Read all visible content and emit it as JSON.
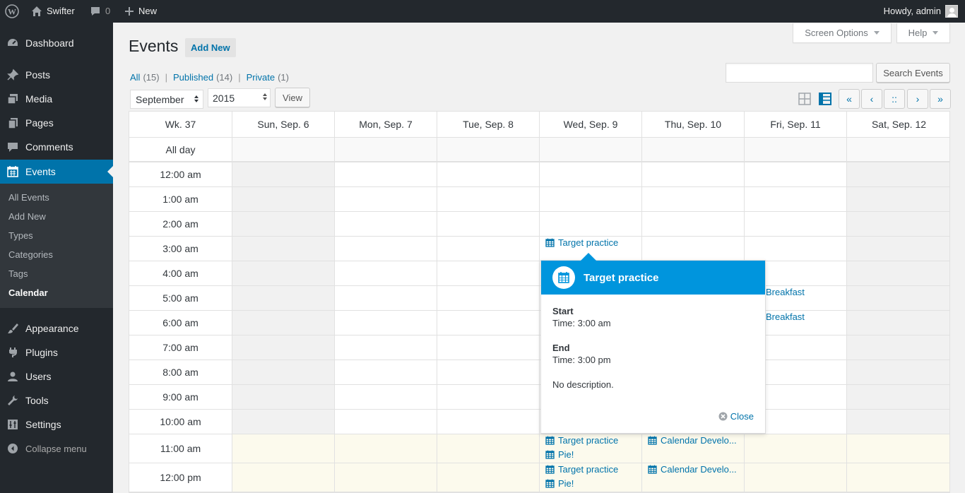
{
  "admin_bar": {
    "site_name": "Swifter",
    "comments_count": "0",
    "new_label": "New",
    "howdy": "Howdy, admin"
  },
  "sidebar": {
    "items": [
      {
        "label": "Dashboard",
        "icon": "dashboard-icon"
      },
      {
        "label": "Posts",
        "icon": "pin-icon"
      },
      {
        "label": "Media",
        "icon": "media-icon"
      },
      {
        "label": "Pages",
        "icon": "pages-icon"
      },
      {
        "label": "Comments",
        "icon": "comment-icon"
      },
      {
        "label": "Events",
        "icon": "calendar-icon",
        "current": true
      },
      {
        "label": "Appearance",
        "icon": "brush-icon"
      },
      {
        "label": "Plugins",
        "icon": "plug-icon"
      },
      {
        "label": "Users",
        "icon": "user-icon"
      },
      {
        "label": "Tools",
        "icon": "wrench-icon"
      },
      {
        "label": "Settings",
        "icon": "settings-icon"
      }
    ],
    "submenu": [
      "All Events",
      "Add New",
      "Types",
      "Categories",
      "Tags",
      "Calendar"
    ],
    "submenu_current": "Calendar",
    "collapse_label": "Collapse menu"
  },
  "header": {
    "screen_options": "Screen Options",
    "help": "Help",
    "title": "Events",
    "add_new": "Add New"
  },
  "filters": {
    "all_label": "All",
    "all_count": "(15)",
    "published_label": "Published",
    "published_count": "(14)",
    "private_label": "Private",
    "private_count": "(1)"
  },
  "search": {
    "button": "Search Events",
    "value": ""
  },
  "controls": {
    "month": "September",
    "year": "2015",
    "view_button": "View",
    "nav": [
      "«",
      "‹",
      "::",
      "›",
      "»"
    ]
  },
  "calendar": {
    "week_label": "Wk. 37",
    "days": [
      "Sun, Sep. 6",
      "Mon, Sep. 7",
      "Tue, Sep. 8",
      "Wed, Sep. 9",
      "Thu, Sep. 10",
      "Fri, Sep. 11",
      "Sat, Sep. 12"
    ],
    "all_day_label": "All day",
    "times": [
      "12:00 am",
      "1:00 am",
      "2:00 am",
      "3:00 am",
      "4:00 am",
      "5:00 am",
      "6:00 am",
      "7:00 am",
      "8:00 am",
      "9:00 am",
      "10:00 am",
      "11:00 am",
      "12:00 pm"
    ],
    "events": [
      {
        "title": "Target practice"
      },
      {
        "title": "Breakfast"
      },
      {
        "title": "Breakfast"
      },
      {
        "title": "Target practice"
      },
      {
        "title": "Pie!"
      },
      {
        "title": "Calendar Develo..."
      },
      {
        "title": "Target practice"
      },
      {
        "title": "Pie!"
      },
      {
        "title": "Calendar Develo..."
      }
    ]
  },
  "popup": {
    "title": "Target practice",
    "start_label": "Start",
    "start_time": "Time: 3:00 am",
    "end_label": "End",
    "end_time": "Time: 3:00 pm",
    "description": "No description.",
    "close_label": "Close"
  },
  "colors": {
    "accent": "#0073aa",
    "popup_header": "#0095dd",
    "sidebar_bg": "#23282d",
    "highlight_row": "#fcfaed"
  }
}
